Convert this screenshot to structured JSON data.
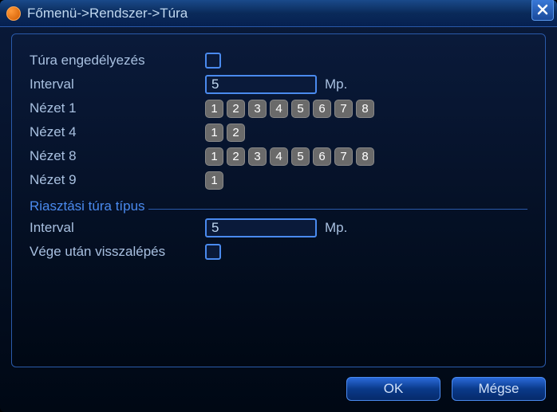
{
  "title": "Főmenü->Rendszer->Túra",
  "rows": {
    "enable": {
      "label": "Túra engedélyezés"
    },
    "interval1": {
      "label": "Interval",
      "value": "5",
      "unit": "Mp."
    },
    "view1": {
      "label": "Nézet 1",
      "buttons": [
        "1",
        "2",
        "3",
        "4",
        "5",
        "6",
        "7",
        "8"
      ]
    },
    "view4": {
      "label": "Nézet 4",
      "buttons": [
        "1",
        "2"
      ]
    },
    "view8": {
      "label": "Nézet 8",
      "buttons": [
        "1",
        "2",
        "3",
        "4",
        "5",
        "6",
        "7",
        "8"
      ]
    },
    "view9": {
      "label": "Nézet 9",
      "buttons": [
        "1"
      ]
    }
  },
  "section": {
    "title": "Riasztási túra típus"
  },
  "rows2": {
    "interval2": {
      "label": "Interval",
      "value": "5",
      "unit": "Mp."
    },
    "return": {
      "label": "Vége után visszalépés"
    }
  },
  "footer": {
    "ok": "OK",
    "cancel": "Mégse"
  }
}
